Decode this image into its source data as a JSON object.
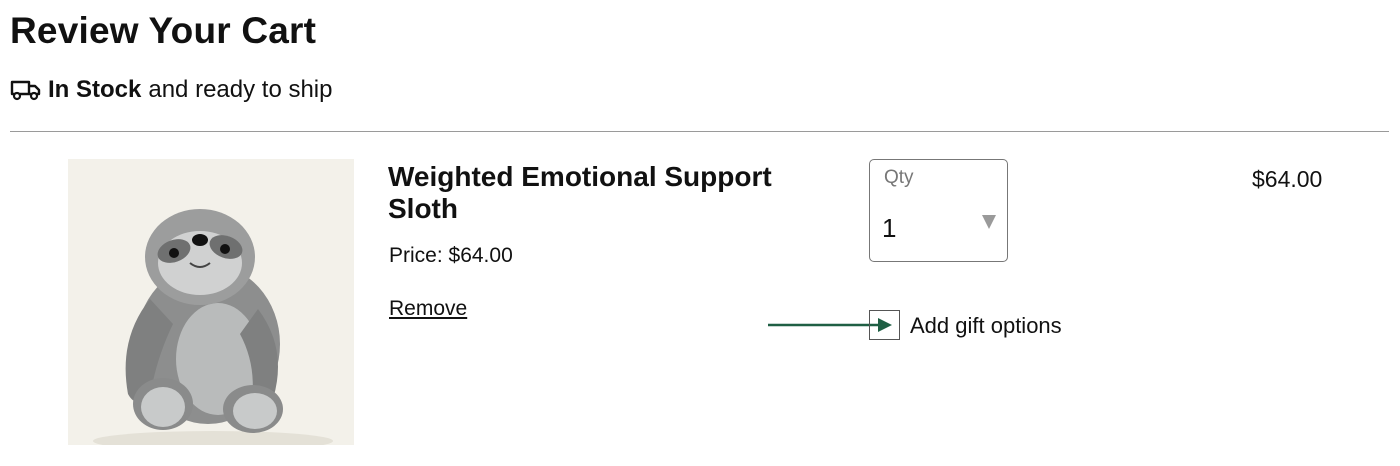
{
  "cart": {
    "title": "Review Your Cart",
    "stock": {
      "icon": "truck-icon",
      "status": "In Stock",
      "suffix": "and ready to ship"
    }
  },
  "item": {
    "image_alt": "Weighted Emotional Support Sloth",
    "name": "Weighted Emotional Support Sloth",
    "price_text": "Price: $64.00",
    "remove_label": "Remove",
    "quantity": {
      "label": "Qty",
      "value": "1"
    },
    "line_total": "$64.00",
    "gift": {
      "label": "Add gift options",
      "arrow_color": "#1f5f44"
    }
  }
}
